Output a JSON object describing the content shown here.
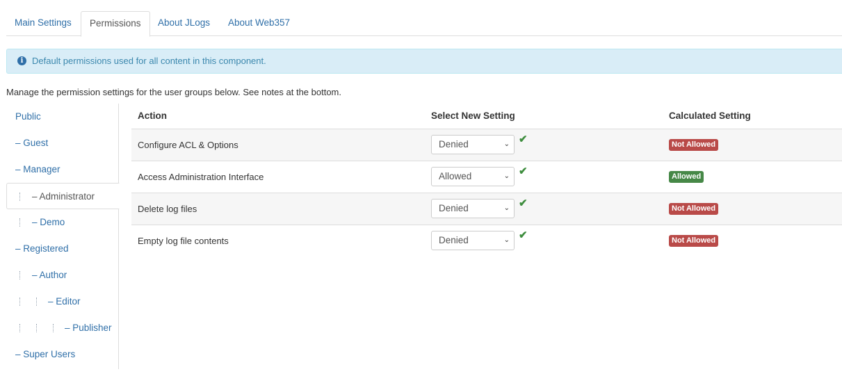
{
  "tabs": [
    {
      "label": "Main Settings"
    },
    {
      "label": "Permissions"
    },
    {
      "label": "About JLogs"
    },
    {
      "label": "About Web357"
    }
  ],
  "alert": {
    "icon": "info-icon",
    "text": "Default permissions used for all content in this component."
  },
  "intro": "Manage the permission settings for the user groups below. See notes at the bottom.",
  "groups": [
    {
      "label": "Public"
    },
    {
      "label": "– Guest"
    },
    {
      "label": "– Manager"
    },
    {
      "label": "– Administrator"
    },
    {
      "label": "– Demo"
    },
    {
      "label": "– Registered"
    },
    {
      "label": "– Author"
    },
    {
      "label": "– Editor"
    },
    {
      "label": "– Publisher"
    },
    {
      "label": "– Super Users"
    }
  ],
  "table": {
    "headers": {
      "action": "Action",
      "select": "Select New Setting",
      "calculated": "Calculated Setting"
    },
    "rows": [
      {
        "action": "Configure ACL & Options",
        "setting": "Denied",
        "calculated": "Not Allowed"
      },
      {
        "action": "Access Administration Interface",
        "setting": "Allowed",
        "calculated": "Allowed"
      },
      {
        "action": "Delete log files",
        "setting": "Denied",
        "calculated": "Not Allowed"
      },
      {
        "action": "Empty log file contents",
        "setting": "Denied",
        "calculated": "Not Allowed"
      }
    ]
  },
  "colors": {
    "link": "#2f6fa8",
    "not_allowed": "#b94a48",
    "allowed": "#468847",
    "check": "#3c8c3c",
    "alert_bg": "#d9edf7"
  }
}
